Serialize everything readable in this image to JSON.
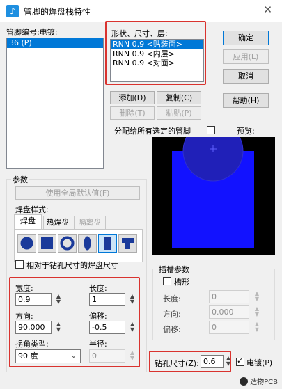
{
  "window": {
    "title": "管脚的焊盘栈特性",
    "close_glyph": "✕"
  },
  "pin_list": {
    "label": "管脚编号:电镀:",
    "items": [
      "36 (P)"
    ]
  },
  "layers": {
    "label": "形状、尺寸、层:",
    "items": [
      "RNN 0.9 <贴装面>",
      "RNN 0.9 <内层>",
      "RNN 0.9 <对面>"
    ]
  },
  "buttons": {
    "ok": "确定",
    "apply": "应用(L)",
    "cancel": "取消",
    "help": "帮助(H)",
    "add": "添加(D)",
    "copy": "复制(C)",
    "delete": "删除(T)",
    "paste": "粘贴(P)"
  },
  "assign_all": {
    "label": "分配给所有选定的管脚",
    "checked": false
  },
  "preview": {
    "label": "预览:",
    "bg_color": "#000000",
    "pad_color": "#1010ff"
  },
  "params": {
    "group_label": "参数",
    "use_default": "使用全局默认值(F)",
    "pad_style_label": "焊盘样式:",
    "tabs": [
      "焊盘",
      "热焊盘",
      "隔离盘"
    ],
    "shapes": [
      "circle-icon",
      "square-icon",
      "ring-icon",
      "oval-icon",
      "rectangle-icon",
      "odd-shape-icon"
    ],
    "relative_label": "相对于钻孔尺寸的焊盘尺寸",
    "relative_checked": false
  },
  "dims": {
    "width_label": "宽度:",
    "width_value": "0.9",
    "length_label": "长度:",
    "length_value": "1",
    "direction_label": "方向:",
    "direction_value": "90.000",
    "offset_label": "偏移:",
    "offset_value": "-0.5",
    "corner_label": "拐角类型:",
    "corner_value": "90 度",
    "radius_label": "半径:",
    "radius_value": "0"
  },
  "slot": {
    "group_label": "插槽参数",
    "slotted_label": "槽形",
    "slotted_checked": false,
    "length_label": "长度:",
    "length_value": "0",
    "direction_label": "方向:",
    "direction_value": "0.000",
    "offset_label": "偏移:",
    "offset_value": "0"
  },
  "drill": {
    "label": "钻孔尺寸(Z):",
    "value": "0.6",
    "plated_label": "电镀(P)",
    "plated_checked": true
  },
  "watermark": {
    "text": "造物PCB"
  },
  "colors": {
    "highlight": "#d9332f",
    "selection": "#0078d7"
  }
}
